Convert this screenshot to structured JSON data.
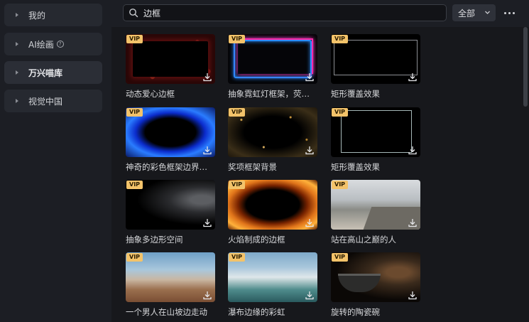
{
  "sidebar": {
    "items": [
      {
        "label": "我的"
      },
      {
        "label": "AI绘画"
      },
      {
        "label": "万兴喵库"
      },
      {
        "label": "视觉中国"
      }
    ]
  },
  "search": {
    "query": "边框"
  },
  "filter": {
    "selected": "全部"
  },
  "badge": "VIP",
  "items": [
    {
      "title": "动态爱心边框",
      "style": "hearts"
    },
    {
      "title": "抽象霓虹灯框架，荧…",
      "style": "neon"
    },
    {
      "title": "矩形覆盖效果",
      "style": "rect"
    },
    {
      "title": "神奇的彩色框架边界…",
      "style": "fire-blue"
    },
    {
      "title": "奖项框架背景",
      "style": "gold"
    },
    {
      "title": "矩形覆盖效果",
      "style": "rect2"
    },
    {
      "title": "抽象多边形空间",
      "style": "smoke"
    },
    {
      "title": "火焰制成的边框",
      "style": "flame"
    },
    {
      "title": "站在高山之巅的人",
      "style": "mountain"
    },
    {
      "title": "一个男人在山坡边走动",
      "style": "canyon"
    },
    {
      "title": "瀑布边缘的彩虹",
      "style": "falls"
    },
    {
      "title": "旋转的陶瓷碗",
      "style": "bowl"
    }
  ],
  "icons": {
    "search": "search-icon",
    "filter": "chevron-down-icon",
    "more": "more-icon",
    "download": "download-icon",
    "help": "help-icon",
    "caret": "caret-right-icon"
  },
  "colors": {
    "vip_badge": "#f3c36a",
    "background": "#17181c",
    "sidebar": "#1c1e24"
  }
}
